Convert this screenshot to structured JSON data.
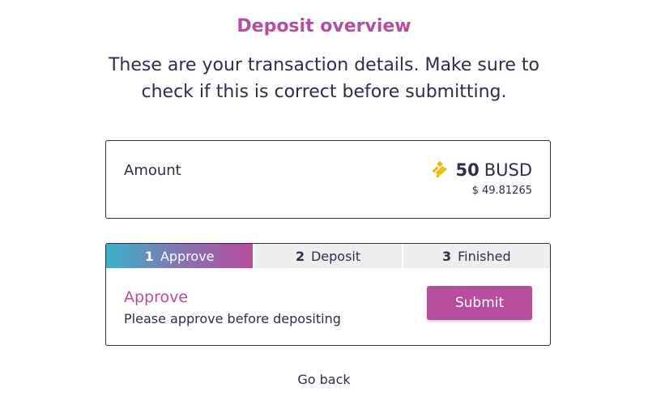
{
  "header": {
    "title": "Deposit overview",
    "subtitle": "These are your transaction details. Make sure to check if this is correct before submitting."
  },
  "amount": {
    "label": "Amount",
    "value": "50",
    "currency": "BUSD",
    "usd_value": "$ 49.81265",
    "icon": "busd-coin-icon",
    "icon_color": "#f0b90b"
  },
  "steps": {
    "tabs": [
      {
        "number": "1",
        "label": "Approve"
      },
      {
        "number": "2",
        "label": "Deposit"
      },
      {
        "number": "3",
        "label": "Finished"
      }
    ],
    "active_index": 0,
    "current": {
      "title": "Approve",
      "description": "Please approve before depositing"
    },
    "submit_label": "Submit"
  },
  "footer": {
    "go_back_label": "Go back"
  },
  "colors": {
    "accent": "#b64d9d",
    "text": "#2c2f45",
    "gradient_start": "#3ab3c9",
    "tab_inactive_bg": "#eeeef0"
  }
}
